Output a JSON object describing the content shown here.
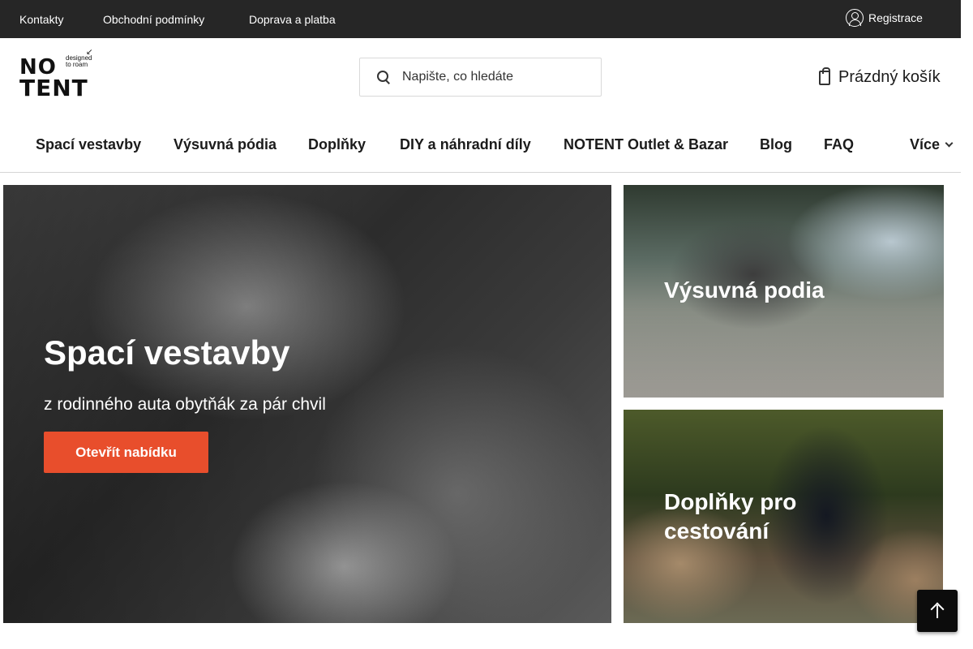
{
  "topbar": {
    "links": [
      "Kontakty",
      "Obchodní podmínky",
      "Doprava a platba"
    ],
    "register_label": "Registrace"
  },
  "header": {
    "logo_line1": "NO",
    "logo_line2": "TENT",
    "logo_tagline": "designed to roam",
    "search_placeholder": "Napište, co hledáte",
    "cart_label": "Prázdný košík"
  },
  "nav": {
    "items": [
      "Spací vestavby",
      "Výsuvná pódia",
      "Doplňky",
      "DIY a náhradní díly",
      "NOTENT Outlet & Bazar",
      "Blog",
      "FAQ"
    ],
    "more_label": "Více"
  },
  "hero": {
    "title": "Spací vestavby",
    "subtitle": "z rodinného auta obytňák za pár chvil",
    "button_label": "Otevřít nabídku"
  },
  "cards": [
    {
      "label": "Výsuvná podia"
    },
    {
      "label": "Doplňky pro cestování"
    }
  ],
  "colors": {
    "topbar_bg": "#262626",
    "accent": "#e84e2c"
  }
}
